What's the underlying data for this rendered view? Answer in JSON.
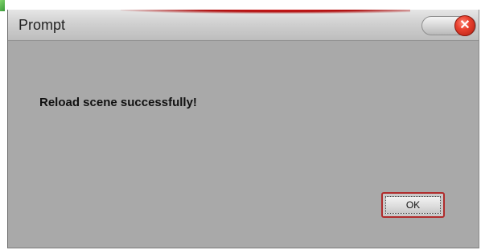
{
  "dialog": {
    "title": "Prompt",
    "message": "Reload scene successfully!",
    "ok_label": "OK",
    "close_icon_glyph": "✕"
  },
  "icons": {
    "close": "close-icon"
  },
  "colors": {
    "dialog_background": "#a9a9a9",
    "title_bar": "#d0d0d0",
    "accent_red": "#b02c2c",
    "close_button_red": "#e8402e"
  }
}
